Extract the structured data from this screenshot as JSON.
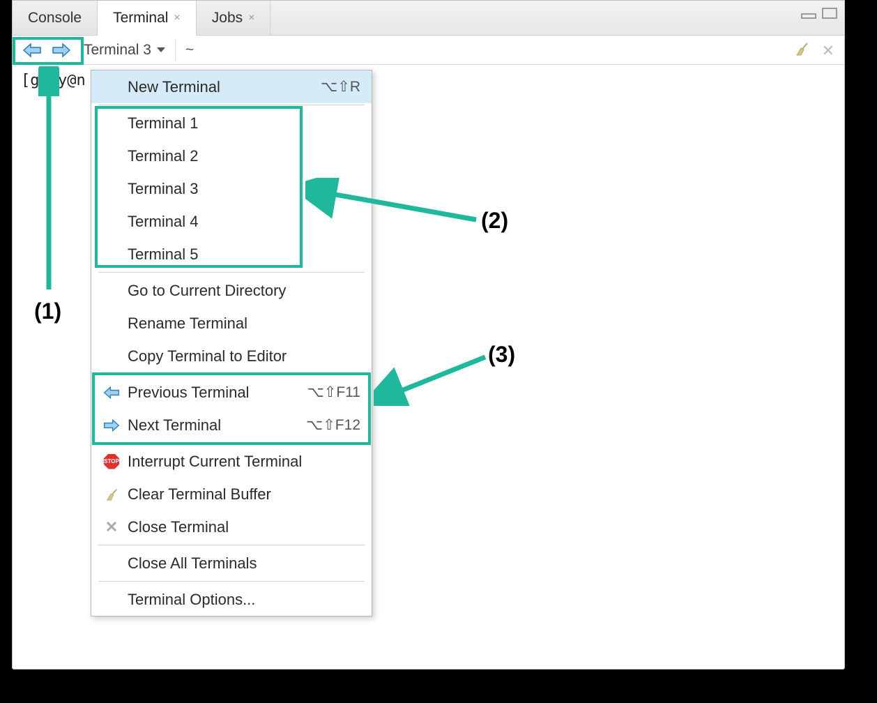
{
  "tabs": {
    "console": "Console",
    "terminal": "Terminal",
    "jobs": "Jobs"
  },
  "toolbar": {
    "selector_label": "Terminal 3",
    "cwd": "~"
  },
  "prompt": "[gary@n",
  "menu": {
    "new_terminal": "New Terminal",
    "new_terminal_shortcut": "⌥⇧R",
    "terminals": [
      "Terminal 1",
      "Terminal 2",
      "Terminal 3",
      "Terminal 4",
      "Terminal 5"
    ],
    "go_current_dir": "Go to Current Directory",
    "rename": "Rename Terminal",
    "copy_to_editor": "Copy Terminal to Editor",
    "prev_terminal": "Previous Terminal",
    "prev_shortcut": "⌥⇧F11",
    "next_terminal": "Next Terminal",
    "next_shortcut": "⌥⇧F12",
    "interrupt": "Interrupt Current Terminal",
    "clear_buffer": "Clear Terminal Buffer",
    "close_terminal": "Close Terminal",
    "close_all": "Close All Terminals",
    "options": "Terminal Options..."
  },
  "annotations": {
    "a1": "(1)",
    "a2": "(2)",
    "a3": "(3)"
  },
  "colors": {
    "accent": "#1fb89c",
    "arrow_fill": "#9fd1f2",
    "arrow_stroke": "#2a79b8"
  }
}
